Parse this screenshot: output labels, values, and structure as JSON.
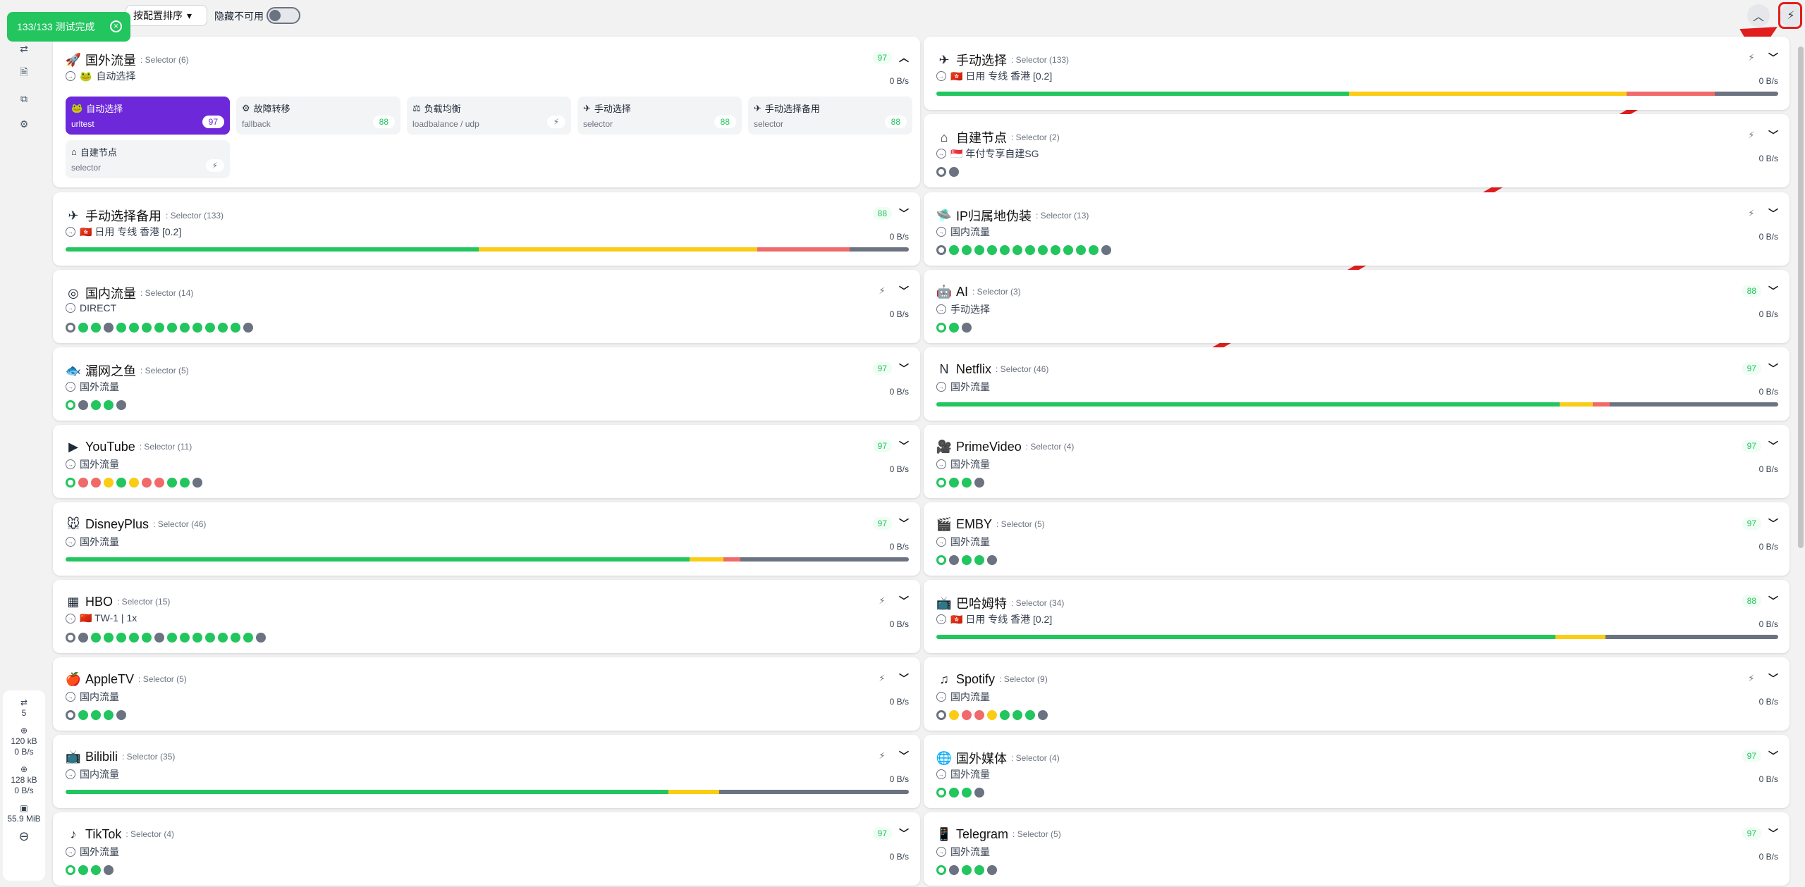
{
  "toast": {
    "text": "133/133 测试完成"
  },
  "topbar": {
    "sort_label": "按配置排序",
    "hide_label": "隐藏不可用"
  },
  "sidebar": {
    "conn_count": "5",
    "dl_total": "120 kB",
    "dl_speed": "0 B/s",
    "ul_total": "128 kB",
    "ul_speed": "0 B/s",
    "mem": "55.9 MiB"
  },
  "main_group": {
    "name": "国外流量",
    "type": ": Selector (6)",
    "sub": "自动选择",
    "latency": "97",
    "speed": "0 B/s",
    "proxies": [
      {
        "name": "自动选择",
        "type": "urltest",
        "latency": "97"
      },
      {
        "name": "故障转移",
        "type": "fallback",
        "latency": "88"
      },
      {
        "name": "负载均衡",
        "type": "loadbalance / udp",
        "latency": "⚡"
      },
      {
        "name": "手动选择",
        "type": "selector",
        "latency": "88"
      },
      {
        "name": "手动选择备用",
        "type": "selector",
        "latency": "88"
      },
      {
        "name": "自建节点",
        "type": "selector",
        "latency": "⚡"
      }
    ]
  },
  "left": [
    {
      "name": "手动选择备用",
      "type": ": Selector (133)",
      "sub": "🇭🇰 日用 专线 香港 [0.2]",
      "latency": "88",
      "speed": "0 B/s",
      "icon": "✈"
    },
    {
      "name": "国内流量",
      "type": ": Selector (14)",
      "sub": "DIRECT",
      "latency": "",
      "speed": "0 B/s",
      "icon": "◎"
    },
    {
      "name": "漏网之鱼",
      "type": ": Selector (5)",
      "sub": "国外流量",
      "latency": "97",
      "speed": "0 B/s",
      "icon": "🐟"
    },
    {
      "name": "YouTube",
      "type": ": Selector (11)",
      "sub": "国外流量",
      "latency": "97",
      "speed": "0 B/s",
      "icon": "▶"
    },
    {
      "name": "DisneyPlus",
      "type": ": Selector (46)",
      "sub": "国外流量",
      "latency": "97",
      "speed": "0 B/s",
      "icon": "🐭"
    },
    {
      "name": "HBO",
      "type": ": Selector (15)",
      "sub": "🇨🇳 TW-1 | 1x",
      "latency": "",
      "speed": "0 B/s",
      "icon": "▦"
    },
    {
      "name": "AppleTV",
      "type": ": Selector (5)",
      "sub": "国内流量",
      "latency": "",
      "speed": "0 B/s",
      "icon": "🍎"
    },
    {
      "name": "Bilibili",
      "type": ": Selector (35)",
      "sub": "国内流量",
      "latency": "",
      "speed": "0 B/s",
      "icon": "📺"
    },
    {
      "name": "TikTok",
      "type": ": Selector (4)",
      "sub": "国外流量",
      "latency": "97",
      "speed": "0 B/s",
      "icon": "♪"
    }
  ],
  "right": [
    {
      "name": "手动选择",
      "type": ": Selector (133)",
      "sub": "🇭🇰 日用 专线 香港 [0.2]",
      "latency": "",
      "speed": "0 B/s",
      "icon": "✈"
    },
    {
      "name": "自建节点",
      "type": ": Selector (2)",
      "sub": "🇸🇬 年付专享自建SG",
      "latency": "",
      "speed": "0 B/s",
      "icon": "⌂"
    },
    {
      "name": "IP归属地伪装",
      "type": ": Selector (13)",
      "sub": "国内流量",
      "latency": "",
      "speed": "0 B/s",
      "icon": "🛸"
    },
    {
      "name": "AI",
      "type": ": Selector (3)",
      "sub": "手动选择",
      "latency": "88",
      "speed": "0 B/s",
      "icon": "🤖"
    },
    {
      "name": "Netflix",
      "type": ": Selector (46)",
      "sub": "国外流量",
      "latency": "97",
      "speed": "0 B/s",
      "icon": "N"
    },
    {
      "name": "PrimeVideo",
      "type": ": Selector (4)",
      "sub": "国外流量",
      "latency": "97",
      "speed": "0 B/s",
      "icon": "🎥"
    },
    {
      "name": "EMBY",
      "type": ": Selector (5)",
      "sub": "国外流量",
      "latency": "97",
      "speed": "0 B/s",
      "icon": "🎬"
    },
    {
      "name": "巴哈姆特",
      "type": ": Selector (34)",
      "sub": "🇭🇰 日用 专线 香港 [0.2]",
      "latency": "88",
      "speed": "0 B/s",
      "icon": "📺"
    },
    {
      "name": "Spotify",
      "type": ": Selector (9)",
      "sub": "国内流量",
      "latency": "",
      "speed": "0 B/s",
      "icon": "♫"
    },
    {
      "name": "国外媒体",
      "type": ": Selector (4)",
      "sub": "国外流量",
      "latency": "97",
      "speed": "0 B/s",
      "icon": "🌐"
    },
    {
      "name": "Telegram",
      "type": ": Selector (5)",
      "sub": "国外流量",
      "latency": "97",
      "speed": "0 B/s",
      "icon": "📱"
    }
  ],
  "colors": {
    "accent": "#6d28d9",
    "good": "#22c55e",
    "warn": "#facc15",
    "bad": "#f06a6a",
    "neutral": "#6b7280"
  }
}
